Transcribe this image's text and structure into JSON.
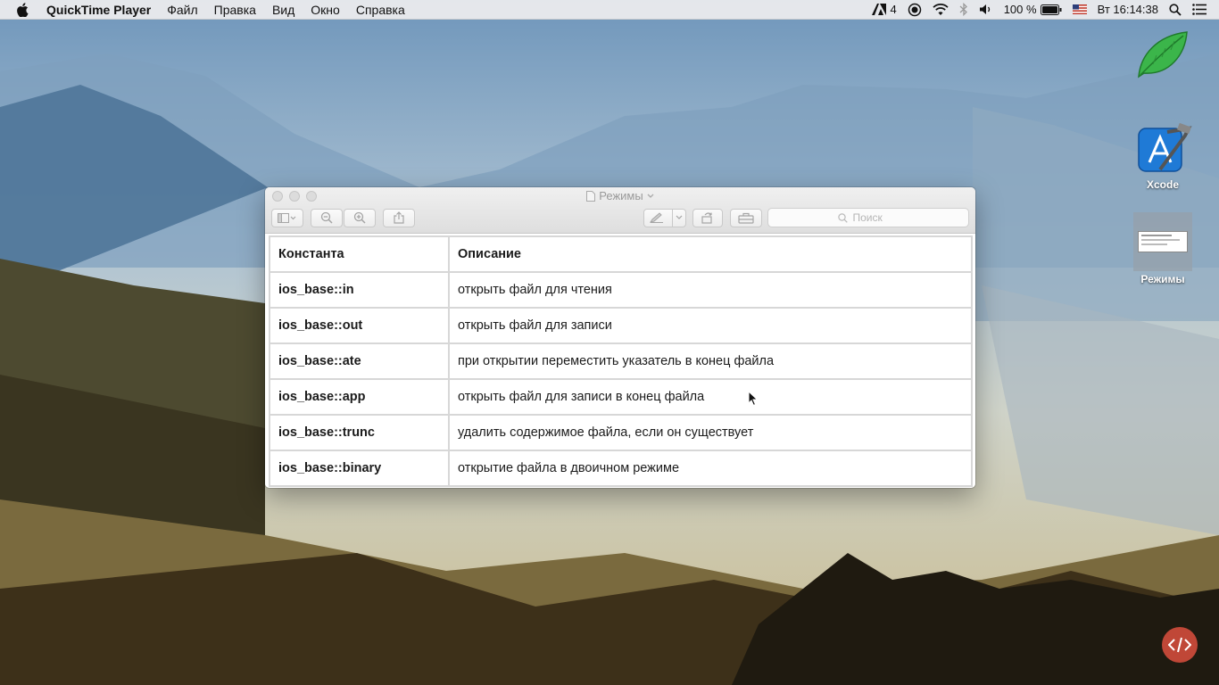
{
  "menubar": {
    "app_name": "QuickTime Player",
    "items": [
      "Файл",
      "Правка",
      "Вид",
      "Окно",
      "Справка"
    ],
    "status": {
      "adobe_count": "4",
      "battery": "100 %",
      "datetime": "Вт 16:14:38"
    }
  },
  "desktop": {
    "icons": [
      {
        "name": "",
        "icon": "leaf-app-icon"
      },
      {
        "name": "Xcode",
        "icon": "xcode-icon"
      },
      {
        "name": "Режимы",
        "icon": "document-thumbnail-icon"
      }
    ]
  },
  "window": {
    "title": "Режимы",
    "search_placeholder": "Поиск",
    "table": {
      "headers": [
        "Константа",
        "Описание"
      ],
      "rows": [
        [
          "ios_base::in",
          "открыть файл для чтения"
        ],
        [
          "ios_base::out",
          "открыть файл для записи"
        ],
        [
          "ios_base::ate",
          "при открытии переместить указатель в конец файла"
        ],
        [
          "ios_base::app",
          "открыть файл для записи в конец файла"
        ],
        [
          "ios_base::trunc",
          "удалить содержимое файла, если он существует"
        ],
        [
          "ios_base::binary",
          "открытие файла в двоичном режиме"
        ]
      ]
    }
  },
  "colors": {
    "watermark": "#d24c3c",
    "menubar_bg": "#ececee"
  }
}
